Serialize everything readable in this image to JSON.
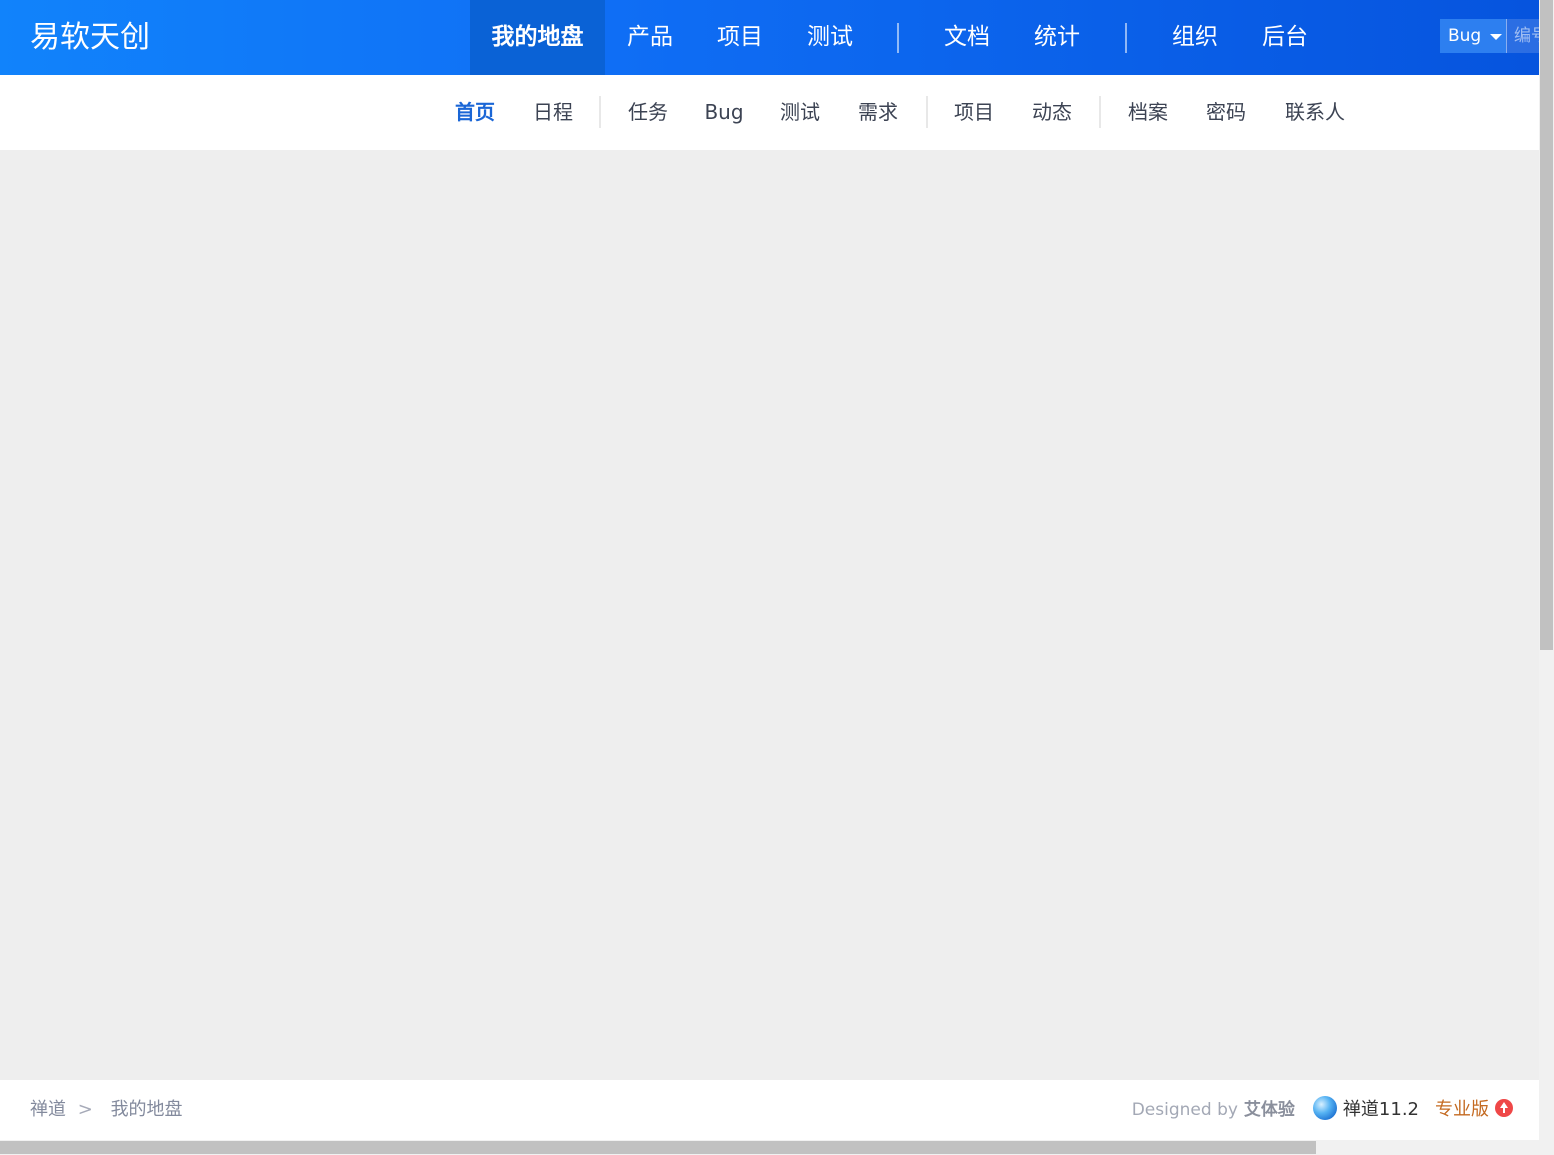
{
  "header": {
    "brand": "易软天创",
    "nav": [
      {
        "label": "我的地盘",
        "active": true
      },
      {
        "label": "产品"
      },
      {
        "label": "项目"
      },
      {
        "label": "测试"
      },
      {
        "label": "文档"
      },
      {
        "label": "统计"
      },
      {
        "label": "组织"
      },
      {
        "label": "后台"
      }
    ],
    "search": {
      "type_label": "Bug",
      "placeholder": "编号"
    }
  },
  "subnav": {
    "items": [
      {
        "label": "首页",
        "active": true
      },
      {
        "label": "日程"
      },
      {
        "label": "任务"
      },
      {
        "label": "Bug"
      },
      {
        "label": "测试"
      },
      {
        "label": "需求"
      },
      {
        "label": "项目"
      },
      {
        "label": "动态"
      },
      {
        "label": "档案"
      },
      {
        "label": "密码"
      },
      {
        "label": "联系人"
      }
    ]
  },
  "footer": {
    "breadcrumb": [
      "禅道",
      ">",
      "我的地盘"
    ],
    "designed_by": "Designed by",
    "designer": "艾体验",
    "version": "禅道11.2",
    "edition": "专业版"
  },
  "colors": {
    "header_start": "#1183fb",
    "header_end": "#0654de",
    "active_sub": "#1a66d6",
    "edition": "#c46a21",
    "upgrade": "#ef4747"
  },
  "icons": [
    "caret-down-icon",
    "zentao-logo-icon",
    "upgrade-arrow-icon"
  ]
}
